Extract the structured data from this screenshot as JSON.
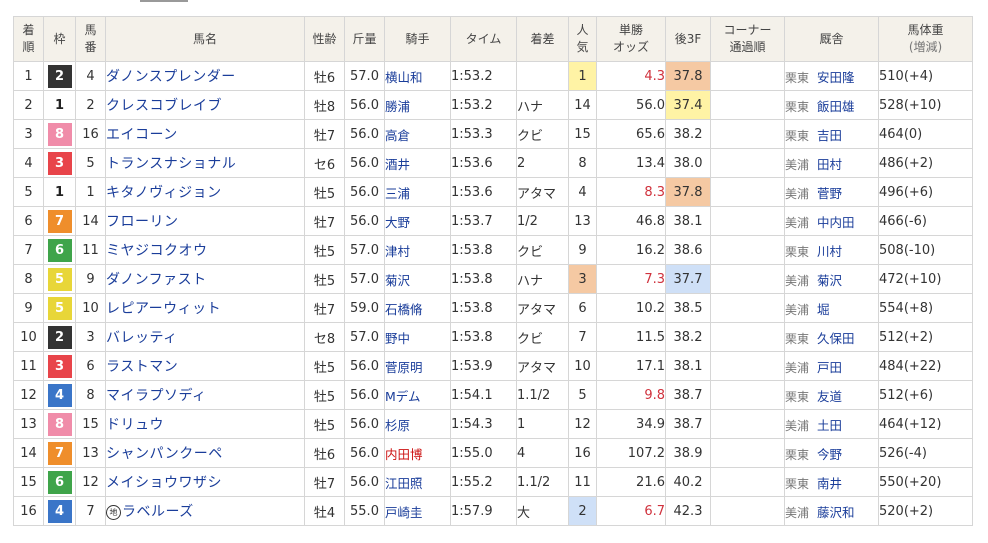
{
  "headers": {
    "rank": "着順",
    "waku": "枠",
    "umaban": "馬番",
    "horse": "馬名",
    "sexage": "性齢",
    "weight": "斤量",
    "jockey": "騎手",
    "time": "タイム",
    "margin": "着差",
    "popularity": "人気",
    "odds": "単勝オッズ",
    "last3f": "後3F",
    "corner": "コーナー通過順",
    "trainer": "厩舎",
    "bodyweight": "馬体重",
    "bodyweight_sub": "(増減)"
  },
  "colors": {
    "waku": {
      "1": {
        "bg": "#ffffff",
        "fg": "#222222"
      },
      "2": {
        "bg": "#333333",
        "fg": "#ffffff"
      },
      "3": {
        "bg": "#e8444a",
        "fg": "#ffffff"
      },
      "4": {
        "bg": "#3a75c8",
        "fg": "#ffffff"
      },
      "5": {
        "bg": "#e8d638",
        "fg": "#ffffff"
      },
      "6": {
        "bg": "#3fa44a",
        "fg": "#ffffff"
      },
      "7": {
        "bg": "#ef8e2b",
        "fg": "#ffffff"
      },
      "8": {
        "bg": "#f08ca9",
        "fg": "#ffffff"
      }
    },
    "rank1": "#fff3a5",
    "rank2": "#cfe0f7",
    "rank3": "#f5c9a3",
    "link": "#1a3d9a",
    "odds_low": "#d0323d"
  },
  "rows": [
    {
      "rank": "1",
      "waku": "2",
      "umaban": "4",
      "horse": "ダノンスプレンダー",
      "chi": false,
      "sexage": "牡6",
      "weight": "57.0",
      "jockey": "横山和",
      "jockey_red": false,
      "time": "1:53.2",
      "margin": "",
      "popularity": "1",
      "odds": "4.3",
      "odds_low": true,
      "last3f": "37.8",
      "f_rank": 1,
      "corner": "",
      "area": "栗東",
      "trainer": "安田隆",
      "bodyweight": "510(+4)"
    },
    {
      "rank": "2",
      "waku": "1",
      "umaban": "2",
      "horse": "クレスコブレイブ",
      "chi": false,
      "sexage": "牡8",
      "weight": "56.0",
      "jockey": "勝浦",
      "jockey_red": false,
      "time": "1:53.2",
      "margin": "ハナ",
      "popularity": "14",
      "odds": "56.0",
      "odds_low": false,
      "last3f": "37.4",
      "f_rank": 2,
      "corner": "",
      "area": "栗東",
      "trainer": "飯田雄",
      "bodyweight": "528(+10)"
    },
    {
      "rank": "3",
      "waku": "8",
      "umaban": "16",
      "horse": "エイコーン",
      "chi": false,
      "sexage": "牡7",
      "weight": "56.0",
      "jockey": "高倉",
      "jockey_red": false,
      "time": "1:53.3",
      "margin": "クビ",
      "popularity": "15",
      "odds": "65.6",
      "odds_low": false,
      "last3f": "38.2",
      "f_rank": 0,
      "corner": "",
      "area": "栗東",
      "trainer": "吉田",
      "bodyweight": "464(0)"
    },
    {
      "rank": "4",
      "waku": "3",
      "umaban": "5",
      "horse": "トランスナショナル",
      "chi": false,
      "sexage": "セ6",
      "weight": "56.0",
      "jockey": "酒井",
      "jockey_red": false,
      "time": "1:53.6",
      "margin": "2",
      "popularity": "8",
      "odds": "13.4",
      "odds_low": false,
      "last3f": "38.0",
      "f_rank": 0,
      "corner": "",
      "area": "美浦",
      "trainer": "田村",
      "bodyweight": "486(+2)"
    },
    {
      "rank": "5",
      "waku": "1",
      "umaban": "1",
      "horse": "キタノヴィジョン",
      "chi": false,
      "sexage": "牡5",
      "weight": "56.0",
      "jockey": "三浦",
      "jockey_red": false,
      "time": "1:53.6",
      "margin": "アタマ",
      "popularity": "4",
      "odds": "8.3",
      "odds_low": true,
      "last3f": "37.8",
      "f_rank": 1,
      "corner": "",
      "area": "美浦",
      "trainer": "菅野",
      "bodyweight": "496(+6)"
    },
    {
      "rank": "6",
      "waku": "7",
      "umaban": "14",
      "horse": "フローリン",
      "chi": false,
      "sexage": "牡7",
      "weight": "56.0",
      "jockey": "大野",
      "jockey_red": false,
      "time": "1:53.7",
      "margin": "1/2",
      "popularity": "13",
      "odds": "46.8",
      "odds_low": false,
      "last3f": "38.1",
      "f_rank": 0,
      "corner": "",
      "area": "美浦",
      "trainer": "中内田",
      "bodyweight": "466(-6)"
    },
    {
      "rank": "7",
      "waku": "6",
      "umaban": "11",
      "horse": "ミヤジコクオウ",
      "chi": false,
      "sexage": "牡5",
      "weight": "57.0",
      "jockey": "津村",
      "jockey_red": false,
      "time": "1:53.8",
      "margin": "クビ",
      "popularity": "9",
      "odds": "16.2",
      "odds_low": false,
      "last3f": "38.6",
      "f_rank": 0,
      "corner": "",
      "area": "栗東",
      "trainer": "川村",
      "bodyweight": "508(-10)"
    },
    {
      "rank": "8",
      "waku": "5",
      "umaban": "9",
      "horse": "ダノンファスト",
      "chi": false,
      "sexage": "牡5",
      "weight": "57.0",
      "jockey": "菊沢",
      "jockey_red": false,
      "time": "1:53.8",
      "margin": "ハナ",
      "popularity": "3",
      "odds": "7.3",
      "odds_low": true,
      "last3f": "37.7",
      "f_rank": 3,
      "corner": "",
      "area": "美浦",
      "trainer": "菊沢",
      "bodyweight": "472(+10)"
    },
    {
      "rank": "9",
      "waku": "5",
      "umaban": "10",
      "horse": "レピアーウィット",
      "chi": false,
      "sexage": "牡7",
      "weight": "59.0",
      "jockey": "石橋脩",
      "jockey_red": false,
      "time": "1:53.8",
      "margin": "アタマ",
      "popularity": "6",
      "odds": "10.2",
      "odds_low": false,
      "last3f": "38.5",
      "f_rank": 0,
      "corner": "",
      "area": "美浦",
      "trainer": "堀",
      "bodyweight": "554(+8)"
    },
    {
      "rank": "10",
      "waku": "2",
      "umaban": "3",
      "horse": "バレッティ",
      "chi": false,
      "sexage": "セ8",
      "weight": "57.0",
      "jockey": "野中",
      "jockey_red": false,
      "time": "1:53.8",
      "margin": "クビ",
      "popularity": "7",
      "odds": "11.5",
      "odds_low": false,
      "last3f": "38.2",
      "f_rank": 0,
      "corner": "",
      "area": "栗東",
      "trainer": "久保田",
      "bodyweight": "512(+2)"
    },
    {
      "rank": "11",
      "waku": "3",
      "umaban": "6",
      "horse": "ラストマン",
      "chi": false,
      "sexage": "牡5",
      "weight": "56.0",
      "jockey": "菅原明",
      "jockey_red": false,
      "time": "1:53.9",
      "margin": "アタマ",
      "popularity": "10",
      "odds": "17.1",
      "odds_low": false,
      "last3f": "38.1",
      "f_rank": 0,
      "corner": "",
      "area": "美浦",
      "trainer": "戸田",
      "bodyweight": "484(+22)"
    },
    {
      "rank": "12",
      "waku": "4",
      "umaban": "8",
      "horse": "マイラプソディ",
      "chi": false,
      "sexage": "牡5",
      "weight": "56.0",
      "jockey": "Mデム",
      "jockey_red": false,
      "time": "1:54.1",
      "margin": "1.1/2",
      "popularity": "5",
      "odds": "9.8",
      "odds_low": true,
      "last3f": "38.7",
      "f_rank": 0,
      "corner": "",
      "area": "栗東",
      "trainer": "友道",
      "bodyweight": "512(+6)"
    },
    {
      "rank": "13",
      "waku": "8",
      "umaban": "15",
      "horse": "ドリュウ",
      "chi": false,
      "sexage": "牡5",
      "weight": "56.0",
      "jockey": "杉原",
      "jockey_red": false,
      "time": "1:54.3",
      "margin": "1",
      "popularity": "12",
      "odds": "34.9",
      "odds_low": false,
      "last3f": "38.7",
      "f_rank": 0,
      "corner": "",
      "area": "美浦",
      "trainer": "土田",
      "bodyweight": "464(+12)"
    },
    {
      "rank": "14",
      "waku": "7",
      "umaban": "13",
      "horse": "シャンパンクーペ",
      "chi": false,
      "sexage": "牡6",
      "weight": "56.0",
      "jockey": "内田博",
      "jockey_red": true,
      "time": "1:55.0",
      "margin": "4",
      "popularity": "16",
      "odds": "107.2",
      "odds_low": false,
      "last3f": "38.9",
      "f_rank": 0,
      "corner": "",
      "area": "栗東",
      "trainer": "今野",
      "bodyweight": "526(-4)"
    },
    {
      "rank": "15",
      "waku": "6",
      "umaban": "12",
      "horse": "メイショウワザシ",
      "chi": false,
      "sexage": "牡7",
      "weight": "56.0",
      "jockey": "江田照",
      "jockey_red": false,
      "time": "1:55.2",
      "margin": "1.1/2",
      "popularity": "11",
      "odds": "21.6",
      "odds_low": false,
      "last3f": "40.2",
      "f_rank": 0,
      "corner": "",
      "area": "栗東",
      "trainer": "南井",
      "bodyweight": "550(+20)"
    },
    {
      "rank": "16",
      "waku": "4",
      "umaban": "7",
      "horse": "ラベルーズ",
      "chi": true,
      "chi_label": "地",
      "sexage": "牡4",
      "weight": "55.0",
      "jockey": "戸崎圭",
      "jockey_red": false,
      "time": "1:57.9",
      "margin": "大",
      "popularity": "2",
      "odds": "6.7",
      "odds_low": true,
      "last3f": "42.3",
      "f_rank": 0,
      "corner": "",
      "area": "美浦",
      "trainer": "藤沢和",
      "bodyweight": "520(+2)"
    }
  ]
}
